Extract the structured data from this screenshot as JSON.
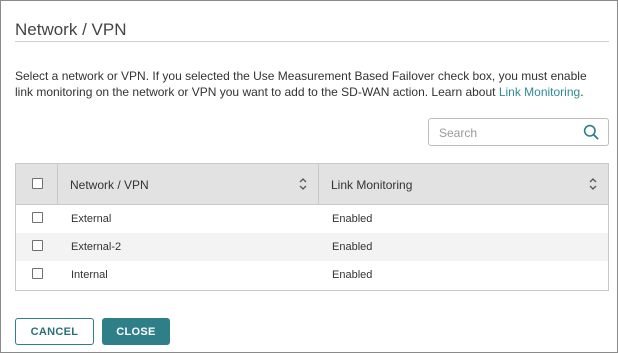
{
  "dialog": {
    "title": "Network / VPN",
    "description_text": "Select a network or VPN. If you selected the Use Measurement Based Failover check box, you must enable link monitoring on the network or VPN you want to add to the SD-WAN action. Learn about ",
    "description_link": "Link Monitoring",
    "description_end": "."
  },
  "search": {
    "placeholder": "Search",
    "icon": "search-icon"
  },
  "table": {
    "headers": {
      "network": "Network / VPN",
      "link": "Link Monitoring"
    },
    "rows": [
      {
        "network": "External",
        "link": "Enabled",
        "checked": false
      },
      {
        "network": "External-2",
        "link": "Enabled",
        "checked": false
      },
      {
        "network": "Internal",
        "link": "Enabled",
        "checked": false
      }
    ]
  },
  "buttons": {
    "cancel": "CANCEL",
    "close": "CLOSE"
  },
  "colors": {
    "accent": "#2f7f89",
    "link": "#2e8a96",
    "header_bg": "#e2e2e2"
  }
}
